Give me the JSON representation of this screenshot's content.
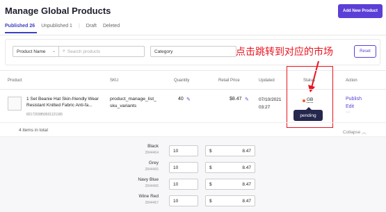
{
  "page": {
    "title": "Manage Global Products",
    "add_button": "Add New Product"
  },
  "tabs": [
    {
      "label": "Published 26"
    },
    {
      "label": "Unpublished 1"
    },
    {
      "label": "Draft"
    },
    {
      "label": "Deleted"
    }
  ],
  "filters": {
    "product_name_select": "Product Name",
    "search_placeholder": "Search products",
    "category_select": "Category",
    "reset_label": "Reset"
  },
  "annotation": {
    "text": "点击跳转到对应的市场",
    "color": "#e8131f"
  },
  "columns": {
    "product": "Product",
    "sku": "SKU",
    "quantity": "Quantity",
    "retail_price": "Retail Price",
    "updated": "Updated",
    "status": "Status",
    "action": "Action"
  },
  "row": {
    "name": "1 Set Beanie Hat Skin-friendly Wear Resistant Knitted Fabric Anti-fa...",
    "id": "8217203859931121165",
    "sku": "product_manage_list_sku_variants",
    "quantity": "40",
    "price": "$8.47",
    "updated_date": "07/10/2021",
    "updated_time": "03:27",
    "status_code": "GB",
    "status_tooltip": "pending",
    "action_publish": "Publish",
    "action_edit": "Edit",
    "action_more": "···"
  },
  "summary": {
    "items_total": "4 items in total",
    "collapse": "Collapse"
  },
  "variants": [
    {
      "name": "Black",
      "id": "2844464",
      "qty": "10",
      "currency": "$",
      "price": "8.47"
    },
    {
      "name": "Grey",
      "id": "2844465",
      "qty": "10",
      "currency": "$",
      "price": "8.47"
    },
    {
      "name": "Navy Blue",
      "id": "2844466",
      "qty": "10",
      "currency": "$",
      "price": "8.47"
    },
    {
      "name": "Wine Red",
      "id": "2844467",
      "qty": "10",
      "currency": "$",
      "price": "8.47"
    }
  ],
  "colors": {
    "accent": "#5b3fd6",
    "status_dot": "#f05c2a",
    "tooltip_bg": "#25274d"
  }
}
